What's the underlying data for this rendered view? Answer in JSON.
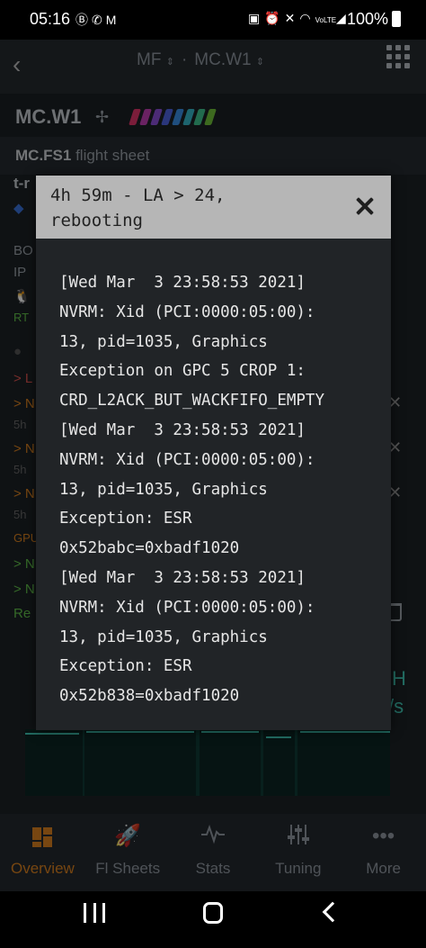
{
  "status_bar": {
    "time": "05:16",
    "left_icons": [
      "bitcoin-icon",
      "whatsapp-icon",
      "gmail-icon"
    ],
    "right_icons": [
      "lock-icon",
      "alarm-icon",
      "mute-icon",
      "wifi-icon",
      "volte-icon",
      "signal-icon"
    ],
    "volte_label": "VoLTE",
    "battery": "100%"
  },
  "header": {
    "farm": "MF",
    "separator": "·",
    "worker": "MC.W1"
  },
  "worker": {
    "name": "MC.W1",
    "gpu_tag_colors": [
      "#e0356b",
      "#c23fb3",
      "#8a4fd8",
      "#4d63e0",
      "#3a8ee6",
      "#35b7c9",
      "#3fc38f",
      "#6fc13a"
    ]
  },
  "flight_sheet": {
    "name": "MC.FS1",
    "suffix": "flight sheet"
  },
  "background_fragments": {
    "t_r": "t-r",
    "bo": "BO",
    "ip": "IP",
    "rt": "RT",
    "l_arrow": "> L",
    "n1": "> N",
    "sh1": "5h",
    "n2": "> N",
    "sh2": "5h",
    "n3": "> N",
    "sh3": "5h",
    "gpu": "GPU",
    "n4": "> N",
    "n5": "> N",
    "rel": "Re",
    "hash_unit": "H",
    "rate_unit": "/s"
  },
  "modal": {
    "title": "4h 59m - LA > 24,\nrebooting",
    "log_lines": [
      "[Wed Mar  3 23:58:53 2021]",
      "NVRM: Xid (PCI:0000:05:00):",
      "13, pid=1035, Graphics",
      "Exception on GPC 5 CROP 1:",
      "CRD_L2ACK_BUT_WACKFIFO_EMPTY",
      "[Wed Mar  3 23:58:53 2021]",
      "NVRM: Xid (PCI:0000:05:00):",
      "13, pid=1035, Graphics",
      "Exception: ESR",
      "0x52babc=0xbadf1020",
      "[Wed Mar  3 23:58:53 2021]",
      "NVRM: Xid (PCI:0000:05:00):",
      "13, pid=1035, Graphics",
      "Exception: ESR",
      "0x52b838=0xbadf1020"
    ]
  },
  "tabs": [
    {
      "label": "Overview",
      "icon": "overview-icon",
      "active": true
    },
    {
      "label": "Fl Sheets",
      "icon": "rocket-icon",
      "active": false
    },
    {
      "label": "Stats",
      "icon": "pulse-icon",
      "active": false
    },
    {
      "label": "Tuning",
      "icon": "sliders-icon",
      "active": false
    },
    {
      "label": "More",
      "icon": "more-dots-icon",
      "active": false
    }
  ],
  "colors": {
    "accent": "#d9801f",
    "teal": "#3fc3b1",
    "modal_header": "#b6b6b6"
  }
}
